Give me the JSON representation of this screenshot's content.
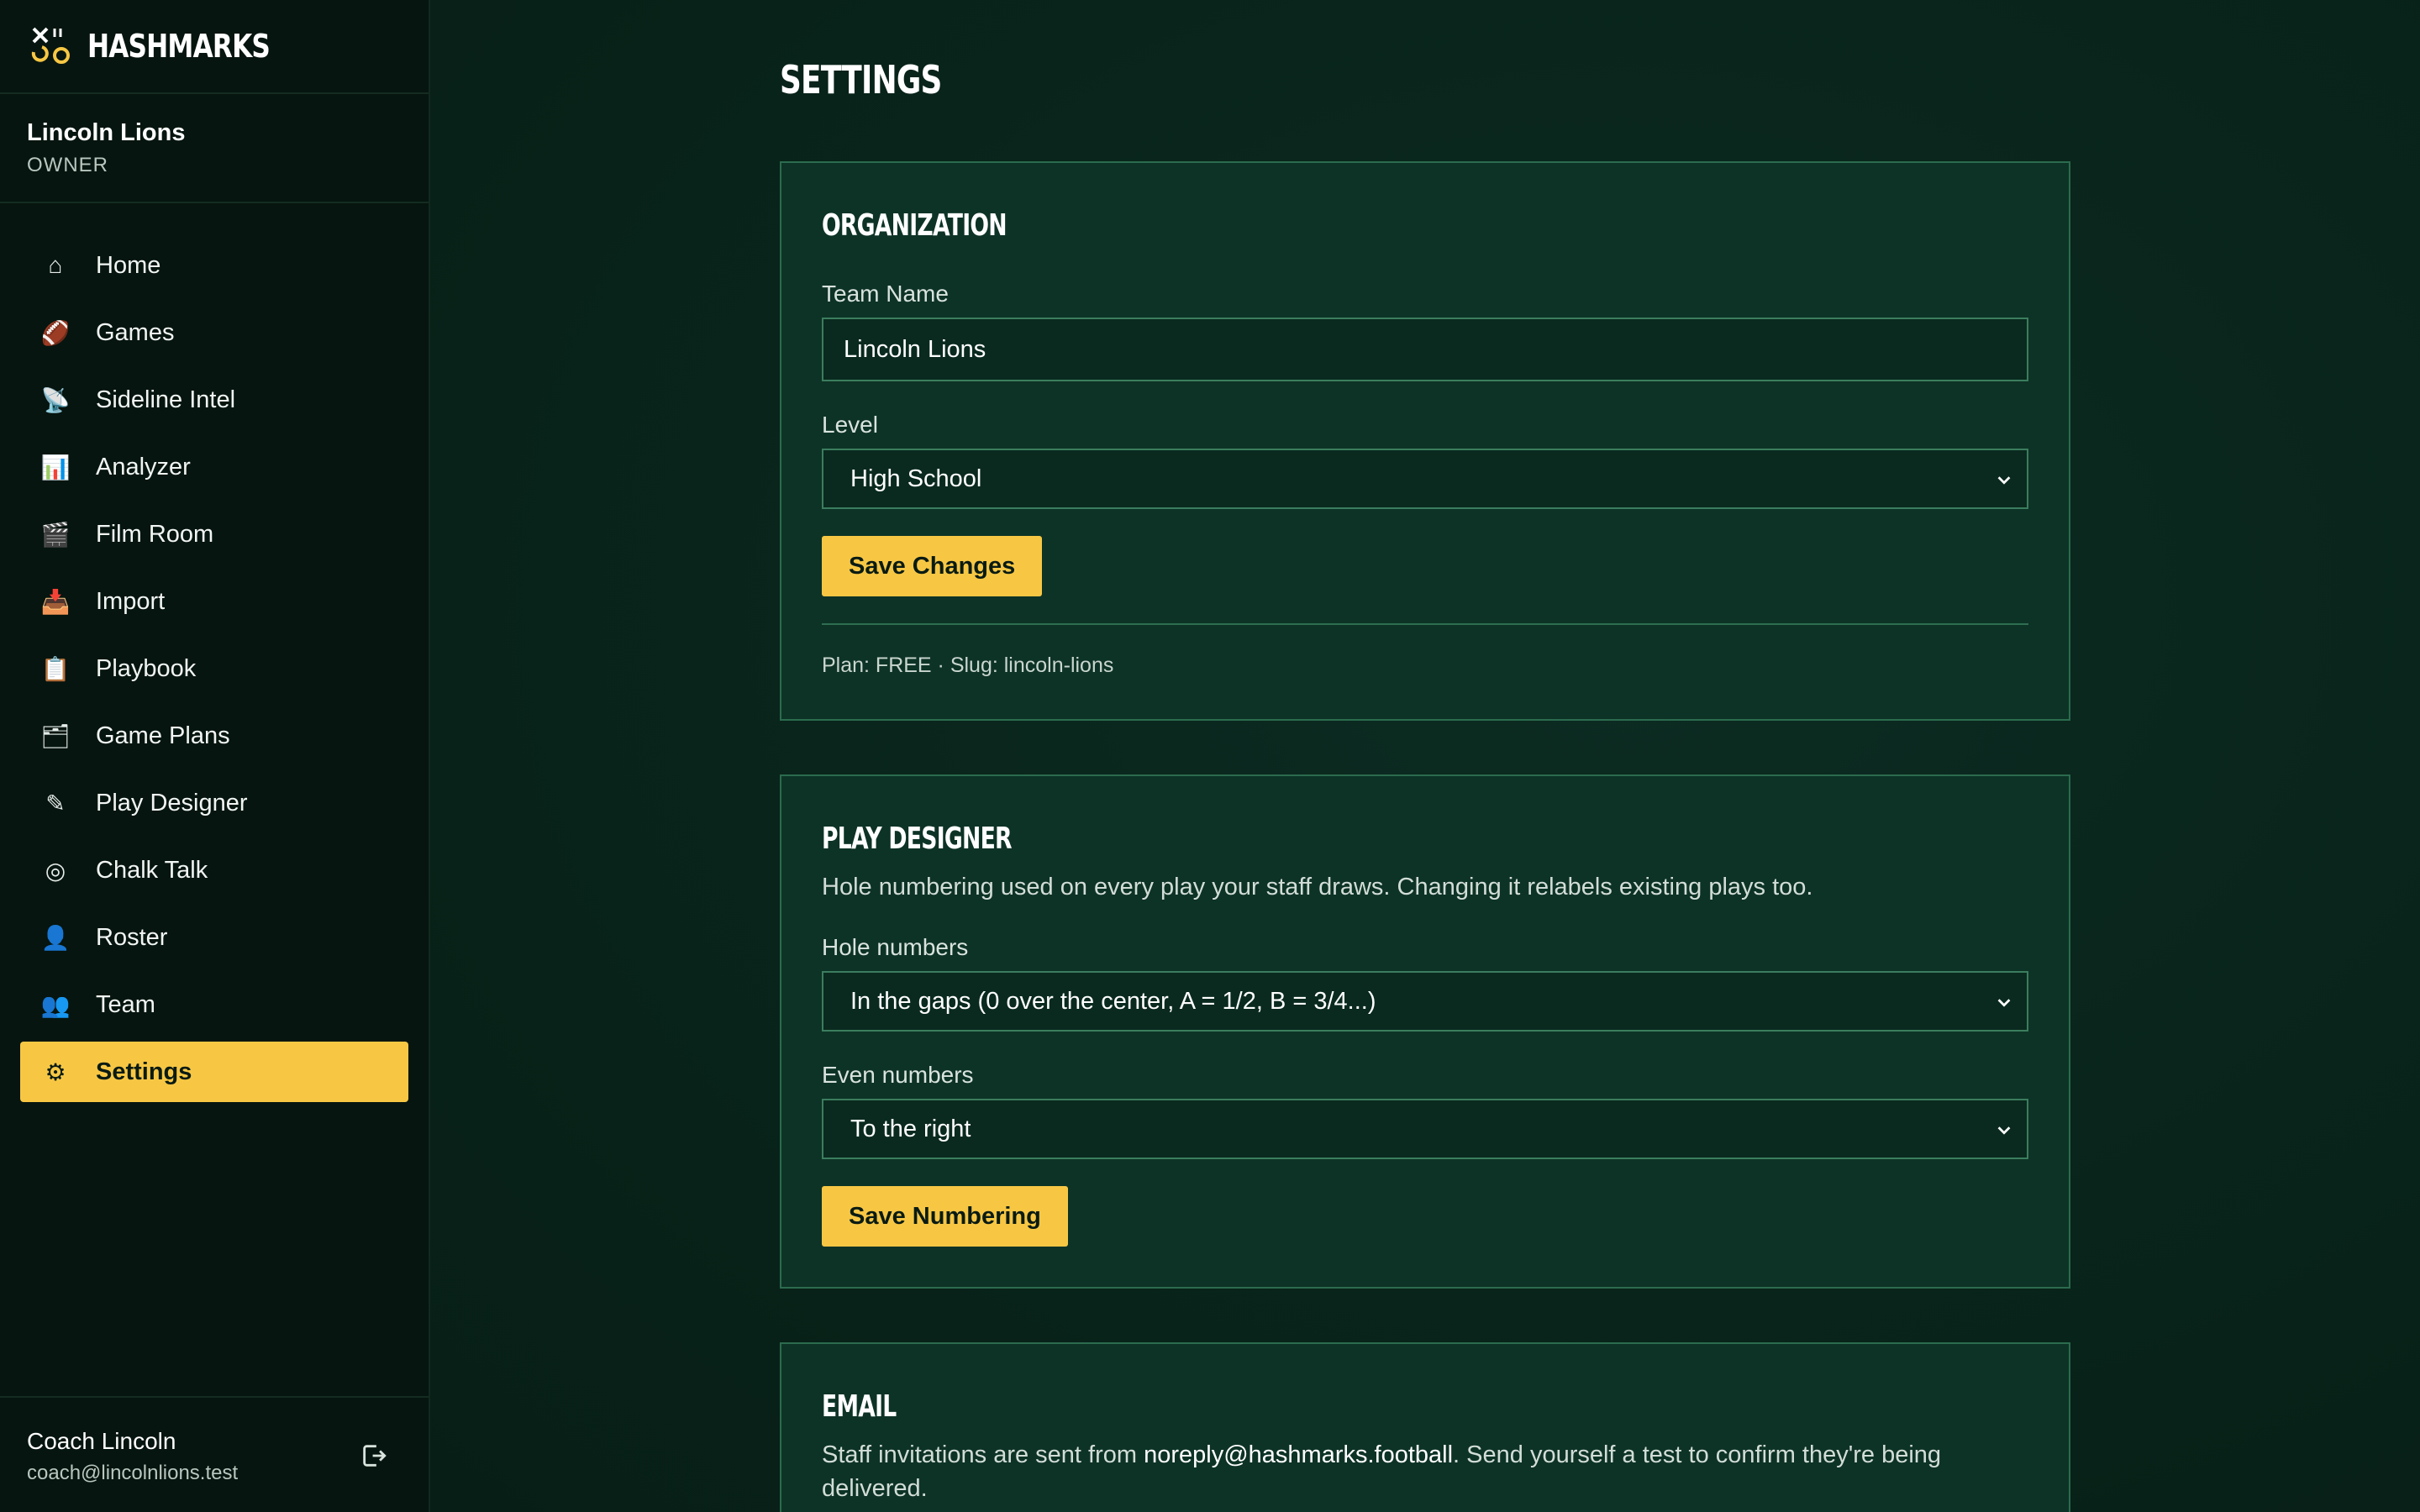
{
  "brand": {
    "name": "HASHMARKS",
    "logo_icon": "x-and-o-logo-icon",
    "accent_color": "#f7c744"
  },
  "org": {
    "name": "Lincoln Lions",
    "role": "OWNER"
  },
  "nav": {
    "items": [
      {
        "label": "Home",
        "icon": "⌂"
      },
      {
        "label": "Games",
        "icon": "🏈"
      },
      {
        "label": "Sideline Intel",
        "icon": "📡"
      },
      {
        "label": "Analyzer",
        "icon": "📊"
      },
      {
        "label": "Film Room",
        "icon": "🎬"
      },
      {
        "label": "Import",
        "icon": "📥"
      },
      {
        "label": "Playbook",
        "icon": "📋"
      },
      {
        "label": "Game Plans",
        "icon": "🗂"
      },
      {
        "label": "Play Designer",
        "icon": "✎"
      },
      {
        "label": "Chalk Talk",
        "icon": "◎"
      },
      {
        "label": "Roster",
        "icon": "👤"
      },
      {
        "label": "Team",
        "icon": "👥"
      },
      {
        "label": "Settings",
        "icon": "⚙"
      }
    ],
    "active": "Settings"
  },
  "user": {
    "name": "Coach Lincoln",
    "email": "coach@lincolnlions.test",
    "logout_icon": "logout-icon"
  },
  "page": {
    "title": "SETTINGS"
  },
  "organization": {
    "title": "ORGANIZATION",
    "team_name_label": "Team Name",
    "team_name_value": "Lincoln Lions",
    "level_label": "Level",
    "level_value": "High School",
    "save_label": "Save Changes",
    "meta": "Plan: FREE · Slug: lincoln-lions"
  },
  "play_designer": {
    "title": "PLAY DESIGNER",
    "description": "Hole numbering used on every play your staff draws. Changing it relabels existing plays too.",
    "hole_label": "Hole numbers",
    "hole_value": "In the gaps (0 over the center, A = 1/2, B = 3/4...)",
    "even_label": "Even numbers",
    "even_value": "To the right",
    "save_label": "Save Numbering"
  },
  "email": {
    "title": "EMAIL",
    "description_before": "Staff invitations are sent from ",
    "sender": "noreply@hashmarks.football",
    "description_after": ". Send yourself a test to confirm they're being delivered."
  }
}
